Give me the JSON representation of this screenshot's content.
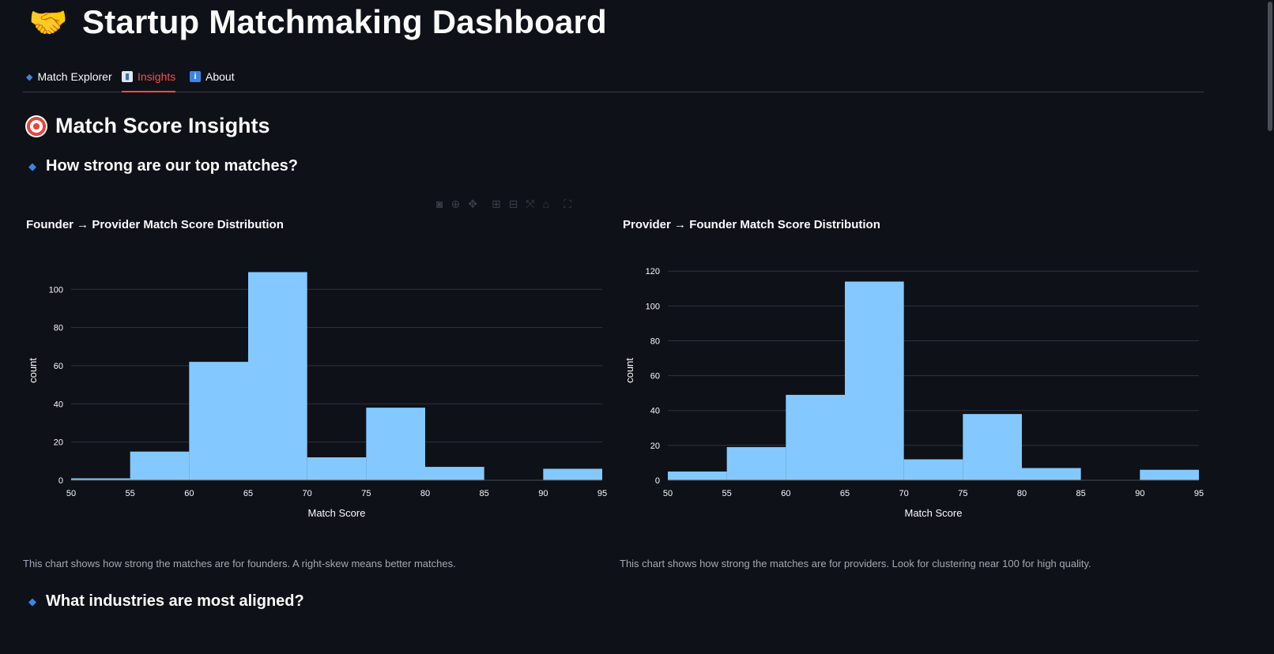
{
  "app": {
    "title": "Startup Matchmaking Dashboard",
    "title_icon": "handshake-emoji"
  },
  "tabs": [
    {
      "label": "Match Explorer",
      "icon": "diamond-icon",
      "active": false
    },
    {
      "label": "Insights",
      "icon": "bar-chart-icon",
      "active": true
    },
    {
      "label": "About",
      "icon": "info-icon",
      "active": false
    }
  ],
  "section": {
    "title": "Match Score Insights",
    "icon": "target-icon"
  },
  "subheaders": {
    "top_matches": "How strong are our top matches?",
    "industries": "What industries are most aligned?"
  },
  "toolbar_icons": [
    "camera-icon",
    "zoom-icon",
    "pan-icon",
    "zoom-in-icon",
    "zoom-out-icon",
    "autoscale-icon",
    "home-icon",
    "fullscreen-icon"
  ],
  "colors": {
    "background": "#0e1117",
    "bar": "#83c9ff",
    "accent": "#ff4b4b",
    "grid": "#31333f"
  },
  "captions": {
    "founder": "This chart shows how strong the matches are for founders. A right-skew means better matches.",
    "provider": "This chart shows how strong the matches are for providers. Look for clustering near 100 for high quality."
  },
  "chart_data": [
    {
      "type": "bar",
      "title": "Founder → Provider Match Score Distribution",
      "xlabel": "Match Score",
      "ylabel": "count",
      "bins": [
        [
          50,
          55
        ],
        [
          55,
          60
        ],
        [
          60,
          65
        ],
        [
          65,
          70
        ],
        [
          70,
          75
        ],
        [
          75,
          80
        ],
        [
          80,
          85
        ],
        [
          85,
          90
        ],
        [
          90,
          95
        ]
      ],
      "values": [
        1,
        15,
        62,
        109,
        12,
        38,
        7,
        0,
        6
      ],
      "xticks": [
        50,
        55,
        60,
        65,
        70,
        75,
        80,
        85,
        90,
        95
      ],
      "yticks": [
        0,
        20,
        40,
        60,
        80,
        100
      ],
      "xlim": [
        50,
        95
      ],
      "ylim": [
        0,
        115
      ],
      "grid": true
    },
    {
      "type": "bar",
      "title": "Provider → Founder Match Score Distribution",
      "xlabel": "Match Score",
      "ylabel": "count",
      "bins": [
        [
          50,
          55
        ],
        [
          55,
          60
        ],
        [
          60,
          65
        ],
        [
          65,
          70
        ],
        [
          70,
          75
        ],
        [
          75,
          80
        ],
        [
          80,
          85
        ],
        [
          85,
          90
        ],
        [
          90,
          95
        ]
      ],
      "values": [
        5,
        19,
        49,
        114,
        12,
        38,
        7,
        0,
        6
      ],
      "xticks": [
        50,
        55,
        60,
        65,
        70,
        75,
        80,
        85,
        90,
        95
      ],
      "yticks": [
        0,
        20,
        40,
        60,
        80,
        100,
        120
      ],
      "xlim": [
        50,
        95
      ],
      "ylim": [
        0,
        126
      ],
      "grid": true
    }
  ]
}
